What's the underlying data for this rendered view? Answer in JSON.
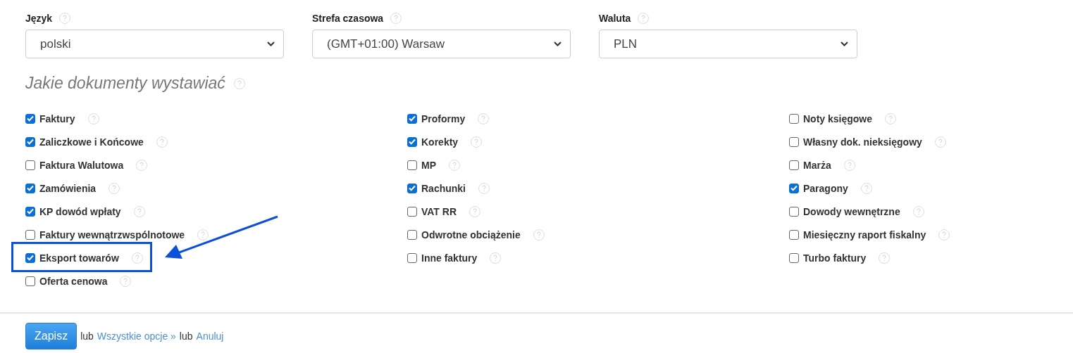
{
  "selects": [
    {
      "label": "Język",
      "value": "polski"
    },
    {
      "label": "Strefa czasowa",
      "value": "(GMT+01:00) Warsaw"
    },
    {
      "label": "Waluta",
      "value": "PLN"
    }
  ],
  "section_title": "Jakie dokumenty wystawiać",
  "columns": [
    [
      {
        "label": "Faktury",
        "checked": true,
        "highlighted": false
      },
      {
        "label": "Zaliczkowe i Końcowe",
        "checked": true,
        "highlighted": false
      },
      {
        "label": "Faktura Walutowa",
        "checked": false,
        "highlighted": false
      },
      {
        "label": "Zamówienia",
        "checked": true,
        "highlighted": false
      },
      {
        "label": "KP dowód wpłaty",
        "checked": true,
        "highlighted": false
      },
      {
        "label": "Faktury wewnątrzwspólnotowe",
        "checked": false,
        "highlighted": false
      },
      {
        "label": "Eksport towarów",
        "checked": true,
        "highlighted": true
      },
      {
        "label": "Oferta cenowa",
        "checked": false,
        "highlighted": false
      }
    ],
    [
      {
        "label": "Proformy",
        "checked": true,
        "highlighted": false
      },
      {
        "label": "Korekty",
        "checked": true,
        "highlighted": false
      },
      {
        "label": "MP",
        "checked": false,
        "highlighted": false
      },
      {
        "label": "Rachunki",
        "checked": true,
        "highlighted": false
      },
      {
        "label": "VAT RR",
        "checked": false,
        "highlighted": false
      },
      {
        "label": "Odwrotne obciążenie",
        "checked": false,
        "highlighted": false
      },
      {
        "label": "Inne faktury",
        "checked": false,
        "highlighted": false
      }
    ],
    [
      {
        "label": "Noty księgowe",
        "checked": false,
        "highlighted": false
      },
      {
        "label": "Własny dok. nieksięgowy",
        "checked": false,
        "highlighted": false
      },
      {
        "label": "Marża",
        "checked": false,
        "highlighted": false
      },
      {
        "label": "Paragony",
        "checked": true,
        "highlighted": false
      },
      {
        "label": "Dowody wewnętrzne",
        "checked": false,
        "highlighted": false
      },
      {
        "label": "Miesięczny raport fiskalny",
        "checked": false,
        "highlighted": false
      },
      {
        "label": "Turbo faktury",
        "checked": false,
        "highlighted": false
      }
    ]
  ],
  "footer": {
    "save": "Zapisz",
    "or_1": "lub",
    "all_options": "Wszystkie opcje »",
    "or_2": "lub",
    "cancel": "Anuluj"
  }
}
